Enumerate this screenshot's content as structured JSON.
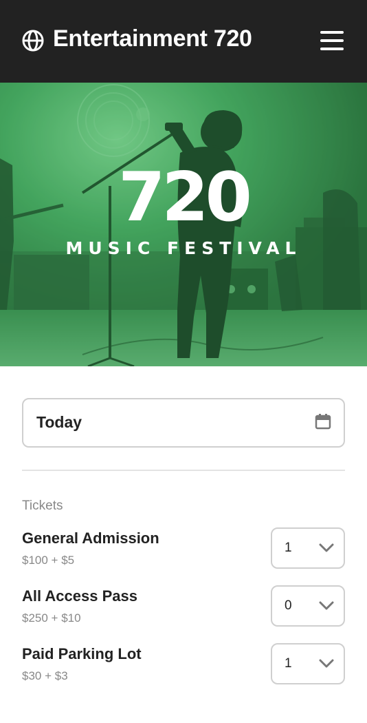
{
  "header": {
    "title": "Entertainment 720",
    "brand_icon": "globe-icon",
    "menu_icon": "hamburger-menu-icon"
  },
  "hero": {
    "number": "720",
    "subtitle": "MUSIC FESTIVAL",
    "tint_color": "#3a9a55"
  },
  "date_picker": {
    "value": "Today",
    "icon": "calendar-icon"
  },
  "tickets": {
    "section_label": "Tickets",
    "items": [
      {
        "name": "General Admission",
        "price": "$100 + $5",
        "quantity": "1"
      },
      {
        "name": "All Access Pass",
        "price": "$250 + $10",
        "quantity": "0"
      },
      {
        "name": "Paid Parking Lot",
        "price": "$30 + $3",
        "quantity": "1"
      }
    ]
  },
  "colors": {
    "header_bg": "#222222",
    "border": "#cfcfcf",
    "muted_text": "#888888"
  }
}
